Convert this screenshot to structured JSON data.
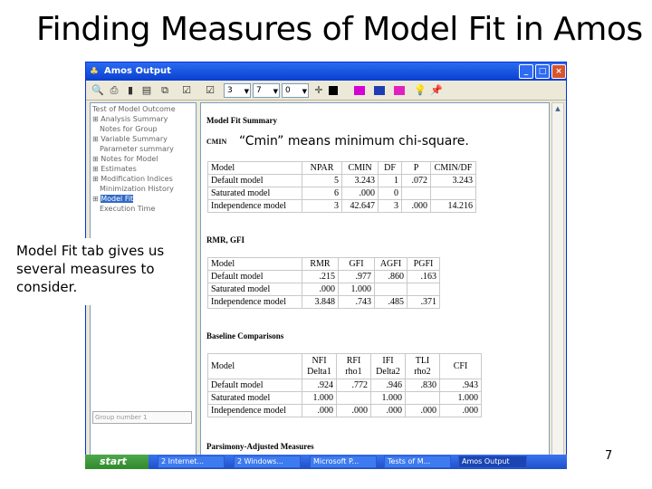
{
  "slide": {
    "title": "Finding Measures of Model Fit in Amos II",
    "page_number": "7"
  },
  "window": {
    "title": "Amos Output",
    "buttons": [
      "_",
      "□",
      "×"
    ]
  },
  "toolbar": {
    "select1": "3",
    "select2": "7",
    "select3": "0"
  },
  "tree": {
    "items": [
      "Test of Model Outcome",
      "Analysis Summary",
      "Notes for Group",
      "Variable Summary",
      "Parameter summary",
      "Notes for Model",
      "Estimates",
      "Modification Indices",
      "Minimization History",
      "Model Fit",
      "Execution Time"
    ],
    "group_label": "Group number 1"
  },
  "content": {
    "heading": "Model Fit Summary",
    "cmin_label": "CMIN",
    "cmin_table": {
      "headers": [
        "Model",
        "NPAR",
        "CMIN",
        "DF",
        "P",
        "CMIN/DF"
      ],
      "rows": [
        [
          "Default model",
          "5",
          "3.243",
          "1",
          ".072",
          "3.243"
        ],
        [
          "Saturated model",
          "6",
          ".000",
          "0",
          "",
          ""
        ],
        [
          "Independence model",
          "3",
          "42.647",
          "3",
          ".000",
          "14.216"
        ]
      ]
    },
    "rmr_heading": "RMR, GFI",
    "rmr_table": {
      "headers": [
        "Model",
        "RMR",
        "GFI",
        "AGFI",
        "PGFI"
      ],
      "rows": [
        [
          "Default model",
          ".215",
          ".977",
          ".860",
          ".163"
        ],
        [
          "Saturated model",
          ".000",
          "1.000",
          "",
          ""
        ],
        [
          "Independence model",
          "3.848",
          ".743",
          ".485",
          ".371"
        ]
      ]
    },
    "baseline_heading": "Baseline Comparisons",
    "baseline_table": {
      "headers": [
        "Model",
        "NFI\nDelta1",
        "RFI\nrho1",
        "IFI\nDelta2",
        "TLI\nrho2",
        "CFI"
      ],
      "rows": [
        [
          "Default model",
          ".924",
          ".772",
          ".946",
          ".830",
          ".943"
        ],
        [
          "Saturated model",
          "1.000",
          "",
          "1.000",
          "",
          "1.000"
        ],
        [
          "Independence model",
          ".000",
          ".000",
          ".000",
          ".000",
          ".000"
        ]
      ]
    },
    "parsimony_heading": "Parsimony-Adjusted Measures"
  },
  "callouts": {
    "cmin_note": "“Cmin” means minimum chi-square.",
    "tab_note": "Model Fit tab gives us several measures to consider."
  },
  "taskbar": {
    "start": "start",
    "tasks": [
      "2 Internet...",
      "2 Windows...",
      "Microsoft P...",
      "Tests of M...",
      "Amos Output"
    ]
  }
}
